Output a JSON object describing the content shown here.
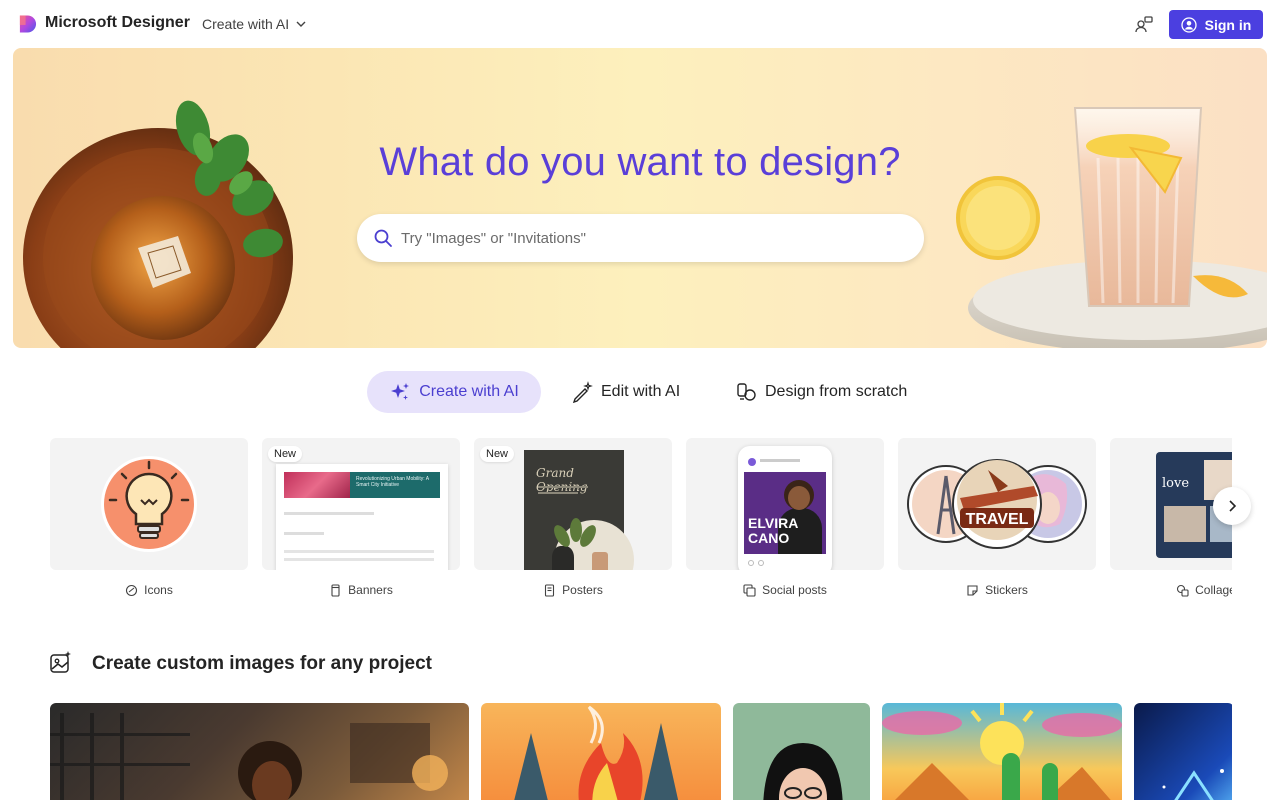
{
  "app": {
    "brand": "Microsoft Designer",
    "nav_dropdown": "Create with AI",
    "sign_in": "Sign in",
    "accent_color": "#4b3fe0"
  },
  "hero": {
    "title": "What do you want to design?",
    "search_placeholder": "Try \"Images\" or \"Invitations\""
  },
  "tabs": [
    {
      "label": "Create with AI",
      "icon": "sparkle-icon",
      "active": true
    },
    {
      "label": "Edit with AI",
      "icon": "magic-pen-icon",
      "active": false
    },
    {
      "label": "Design from scratch",
      "icon": "shapes-icon",
      "active": false
    }
  ],
  "categories": [
    {
      "label": "Icons",
      "icon": "icon-shape-icon",
      "badge": ""
    },
    {
      "label": "Banners",
      "icon": "banner-icon",
      "badge": "New"
    },
    {
      "label": "Posters",
      "icon": "poster-icon",
      "badge": "New"
    },
    {
      "label": "Social posts",
      "icon": "social-post-icon",
      "badge": ""
    },
    {
      "label": "Stickers",
      "icon": "sticker-icon",
      "badge": ""
    },
    {
      "label": "Collages",
      "icon": "collage-icon",
      "badge": ""
    }
  ],
  "thumb_text": {
    "banner_headline": "Revolutionizing Urban Mobility: A Smart City Initiative",
    "poster_headline": "Grand Opening",
    "social_name_1": "ELVIRA",
    "social_name_2": "CANO",
    "sticker_word": "TRAVEL",
    "collage_word": "love"
  },
  "section": {
    "title": "Create custom images for any project"
  }
}
